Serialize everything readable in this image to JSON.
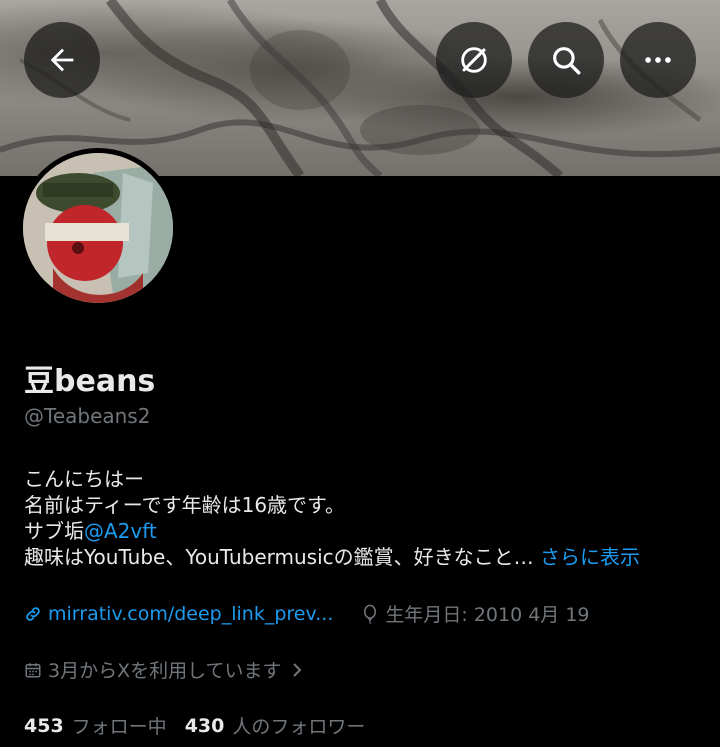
{
  "profile": {
    "display_name": "豆beans",
    "handle": "@Teabeans2"
  },
  "bio": {
    "line1": "こんにちはー",
    "line2": "名前はティーです年齢は16歳です。",
    "line3_prefix": "サブ垢",
    "line3_mention": "@A2vft",
    "line4_text": "趣味はYouTube、YouTubermusicの鑑賞、好きなこと…",
    "line4_more": "さらに表示"
  },
  "meta": {
    "website": "mirrativ.com/deep_link_prev...",
    "birthday": "生年月日: 2010 4月 19",
    "joined": "3月からXを利用しています"
  },
  "stats": {
    "following_count": "453",
    "following_label": "フォロー中",
    "followers_count": "430",
    "followers_label": "人のフォロワー"
  },
  "icons": {
    "back": "back-arrow-icon",
    "grok": "grok-icon",
    "search": "search-icon",
    "more": "more-icon",
    "link": "link-icon",
    "birthday": "balloon-icon",
    "calendar": "calendar-icon",
    "chevron": "chevron-right-icon"
  },
  "colors": {
    "background": "#000000",
    "text": "#e7e9ea",
    "secondary": "#71767b",
    "accent": "#1d9bf0"
  }
}
